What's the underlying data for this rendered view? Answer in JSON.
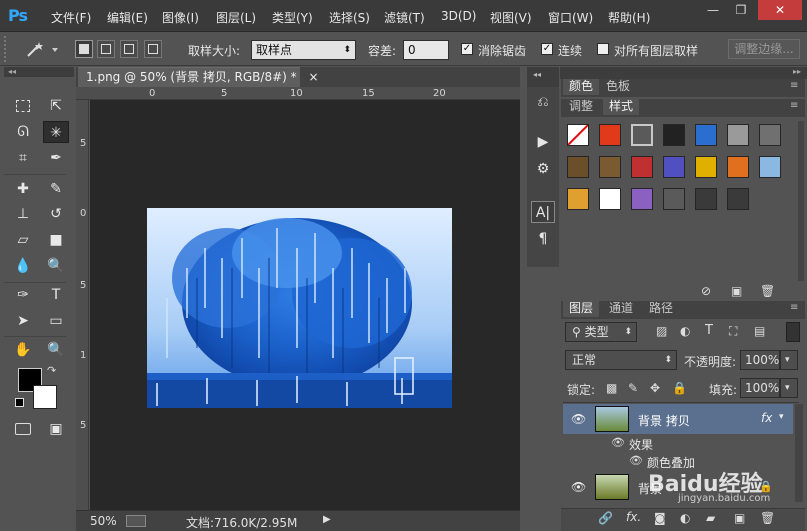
{
  "menubar": {
    "logo": "Ps",
    "items": [
      "文件(F)",
      "编辑(E)",
      "图像(I)",
      "图层(L)",
      "类型(Y)",
      "选择(S)",
      "滤镜(T)",
      "3D(D)",
      "视图(V)",
      "窗口(W)",
      "帮助(H)"
    ],
    "window_controls": [
      "—",
      "❐",
      "✕"
    ]
  },
  "options": {
    "sample_size_label": "取样大小:",
    "sample_size_value": "取样点",
    "tolerance_label": "容差:",
    "tolerance_value": "0",
    "antialias_label": "消除锯齿",
    "antialias_checked": true,
    "contiguous_label": "连续",
    "contiguous_checked": true,
    "all_layers_label": "对所有图层取样",
    "all_layers_checked": false,
    "refine_edge_label": "调整边缘..."
  },
  "document": {
    "tab_title": "1.png @ 50% (背景 拷贝, RGB/8#) *",
    "tab_close": "×",
    "ruler_top": [
      "0",
      "5",
      "10",
      "15",
      "20"
    ],
    "ruler_left": [
      "5",
      "0",
      "5",
      "1",
      "5"
    ]
  },
  "status": {
    "zoom": "50%",
    "doc_info": "文档:716.0K/2.95M",
    "arrow": "▶"
  },
  "colors_panel": {
    "tabs": [
      "颜色",
      "色板"
    ],
    "active": 0
  },
  "styles_panel": {
    "tabs": [
      "调整",
      "样式"
    ],
    "active": 1,
    "swatch_colors": [
      "#ffffff",
      "#e03a1a",
      "#5a5a5a",
      "#222222",
      "#2a6fd0",
      "#9a9a9a",
      "#707070",
      "#6b4e2a",
      "#7a5a30",
      "#c03030",
      "#5050c0",
      "#e0b000",
      "#e07020",
      "#8ab8e0",
      "#e0a030",
      "#ffffff",
      "#8a60c0",
      "#5a5a5a",
      "#3a3a3a",
      "#3a3a3a"
    ]
  },
  "layers_panel": {
    "tabs": [
      "图层",
      "通道",
      "路径"
    ],
    "active": 0,
    "filter_kind": "类型",
    "blend_mode": "正常",
    "opacity_label": "不透明度:",
    "opacity_value": "100%",
    "lock_label": "锁定:",
    "fill_label": "填充:",
    "fill_value": "100%",
    "layers": [
      {
        "name": "背景 拷贝",
        "fx": "fx",
        "selected": true
      },
      {
        "name": "背景",
        "fx": "",
        "selected": false
      }
    ],
    "effects_label": "效果",
    "effect_item": "颜色叠加",
    "footer_fx": "fx."
  },
  "watermark": "Baidu经验",
  "watermark_sub": "jingyan.baidu.com",
  "accent_colors": {
    "ps_blue": "#30a8ff",
    "layer_selected": "#5b6f8f"
  }
}
